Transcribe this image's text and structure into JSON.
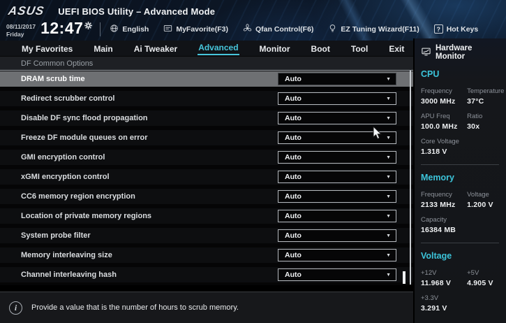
{
  "header": {
    "logo": "ASUS",
    "title": "UEFI BIOS Utility – Advanced Mode",
    "date": "08/11/2017",
    "day": "Friday",
    "time": "12:47",
    "toolbar": [
      {
        "icon": "globe-icon",
        "label": "English"
      },
      {
        "icon": "myfavorite-icon",
        "label": "MyFavorite(F3)"
      },
      {
        "icon": "fan-icon",
        "label": "Qfan Control(F6)"
      },
      {
        "icon": "bulb-icon",
        "label": "EZ Tuning Wizard(F11)"
      },
      {
        "icon": "question-icon",
        "label": "Hot Keys"
      }
    ]
  },
  "tabs": [
    {
      "label": "My Favorites",
      "active": false
    },
    {
      "label": "Main",
      "active": false
    },
    {
      "label": "Ai Tweaker",
      "active": false
    },
    {
      "label": "Advanced",
      "active": true
    },
    {
      "label": "Monitor",
      "active": false
    },
    {
      "label": "Boot",
      "active": false
    },
    {
      "label": "Tool",
      "active": false
    },
    {
      "label": "Exit",
      "active": false
    }
  ],
  "breadcrumb": "DF Common Options",
  "settings": {
    "rows": [
      {
        "label": "DRAM scrub time",
        "value": "Auto",
        "active": true
      },
      {
        "label": "Redirect scrubber control",
        "value": "Auto",
        "active": false
      },
      {
        "label": "Disable DF sync flood propagation",
        "value": "Auto",
        "active": false
      },
      {
        "label": "Freeze DF module queues on error",
        "value": "Auto",
        "active": false
      },
      {
        "label": "GMI encryption control",
        "value": "Auto",
        "active": false
      },
      {
        "label": "xGMI encryption control",
        "value": "Auto",
        "active": false
      },
      {
        "label": "CC6 memory region encryption",
        "value": "Auto",
        "active": false
      },
      {
        "label": "Location of private memory regions",
        "value": "Auto",
        "active": false
      },
      {
        "label": "System probe filter",
        "value": "Auto",
        "active": false
      },
      {
        "label": "Memory interleaving size",
        "value": "Auto",
        "active": false
      },
      {
        "label": "Channel interleaving hash",
        "value": "Auto",
        "active": false
      }
    ]
  },
  "footer": {
    "hint": "Provide a value that is the number of hours to scrub memory."
  },
  "hardware_monitor": {
    "title": "Hardware Monitor",
    "sections": [
      {
        "name": "CPU",
        "metrics": [
          {
            "label": "Frequency",
            "value": "3000 MHz"
          },
          {
            "label": "Temperature",
            "value": "37°C"
          },
          {
            "label": "APU Freq",
            "value": "100.0 MHz"
          },
          {
            "label": "Ratio",
            "value": "30x"
          },
          {
            "label": "Core Voltage",
            "value": "1.318 V"
          }
        ]
      },
      {
        "name": "Memory",
        "metrics": [
          {
            "label": "Frequency",
            "value": "2133 MHz"
          },
          {
            "label": "Voltage",
            "value": "1.200 V"
          },
          {
            "label": "Capacity",
            "value": "16384 MB"
          }
        ]
      },
      {
        "name": "Voltage",
        "metrics": [
          {
            "label": "+12V",
            "value": "11.968 V"
          },
          {
            "label": "+5V",
            "value": "4.905 V"
          },
          {
            "label": "+3.3V",
            "value": "3.291 V"
          }
        ]
      }
    ]
  },
  "colors": {
    "accent": "#47c6db",
    "selected_row": "#6e7073",
    "header_navy": "#0c1727"
  }
}
